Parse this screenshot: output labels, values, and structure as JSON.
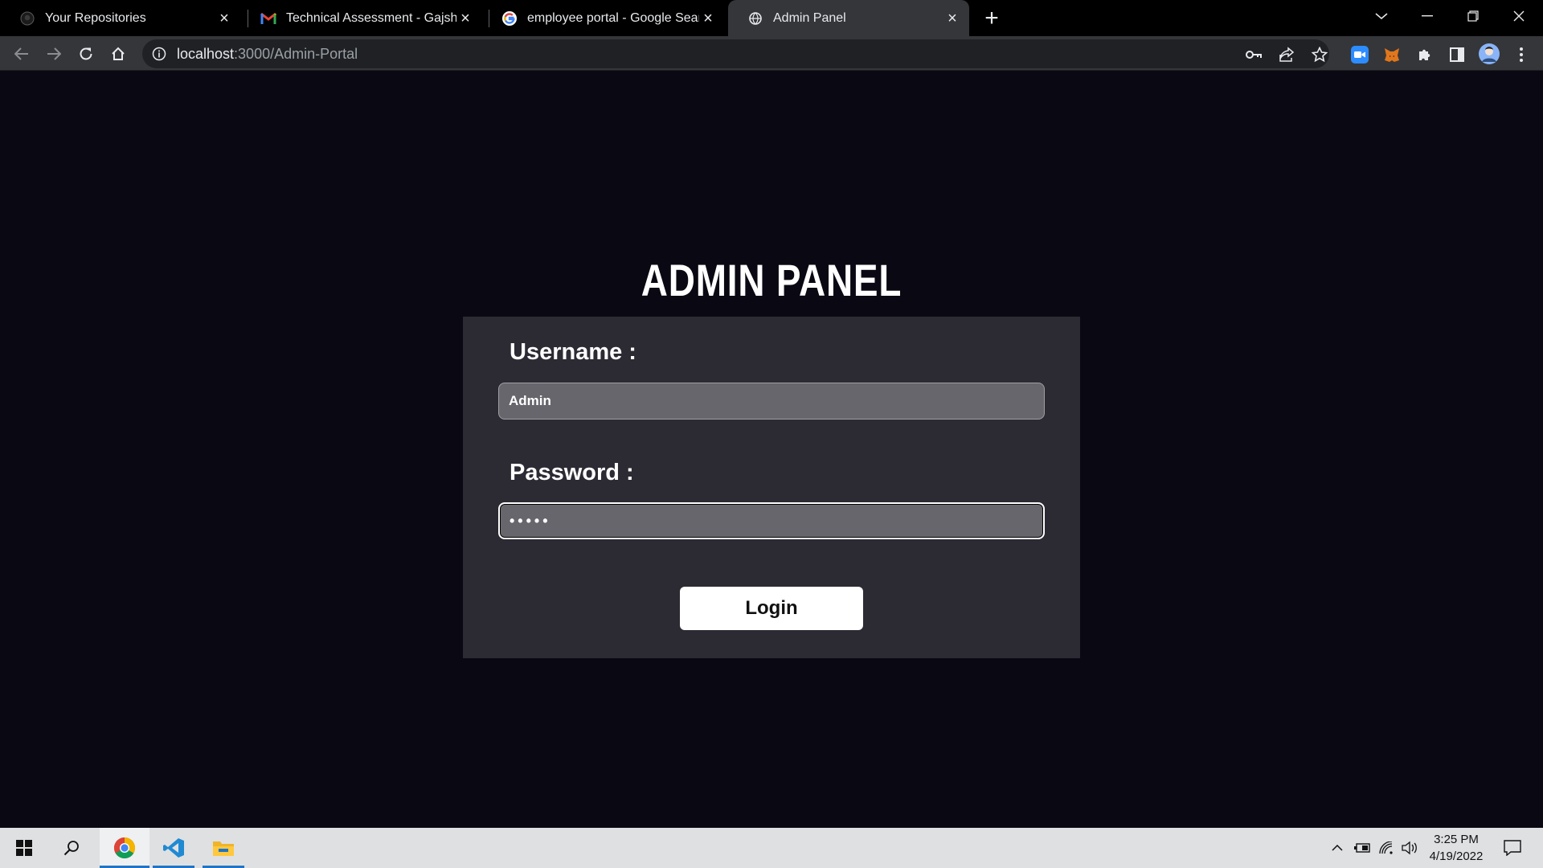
{
  "browser": {
    "tabs": [
      {
        "title": "Your Repositories",
        "icon": "github-icon",
        "active": false
      },
      {
        "title": "Technical Assessment - Gajshield",
        "icon": "gmail-icon",
        "active": false
      },
      {
        "title": "employee portal - Google Search",
        "icon": "google-icon",
        "active": false
      },
      {
        "title": "Admin Panel",
        "icon": "loading-globe-icon",
        "active": true
      }
    ],
    "url_host": "localhost",
    "url_path": ":3000/Admin-Portal"
  },
  "page": {
    "title": "ADMIN PANEL",
    "username_label": "Username :",
    "username_value": "Admin",
    "password_label": "Password :",
    "password_masked": "•••••",
    "login_label": "Login"
  },
  "taskbar": {
    "time": "3:25 PM",
    "date": "4/19/2022",
    "apps": [
      "windows-start-icon",
      "search-icon",
      "chrome-icon",
      "vscode-icon",
      "file-explorer-icon"
    ]
  },
  "colors": {
    "page_bg": "#0a0913",
    "panel_bg": "#2c2b34",
    "field_bg": "#67666d",
    "button_bg": "#ffffff"
  }
}
